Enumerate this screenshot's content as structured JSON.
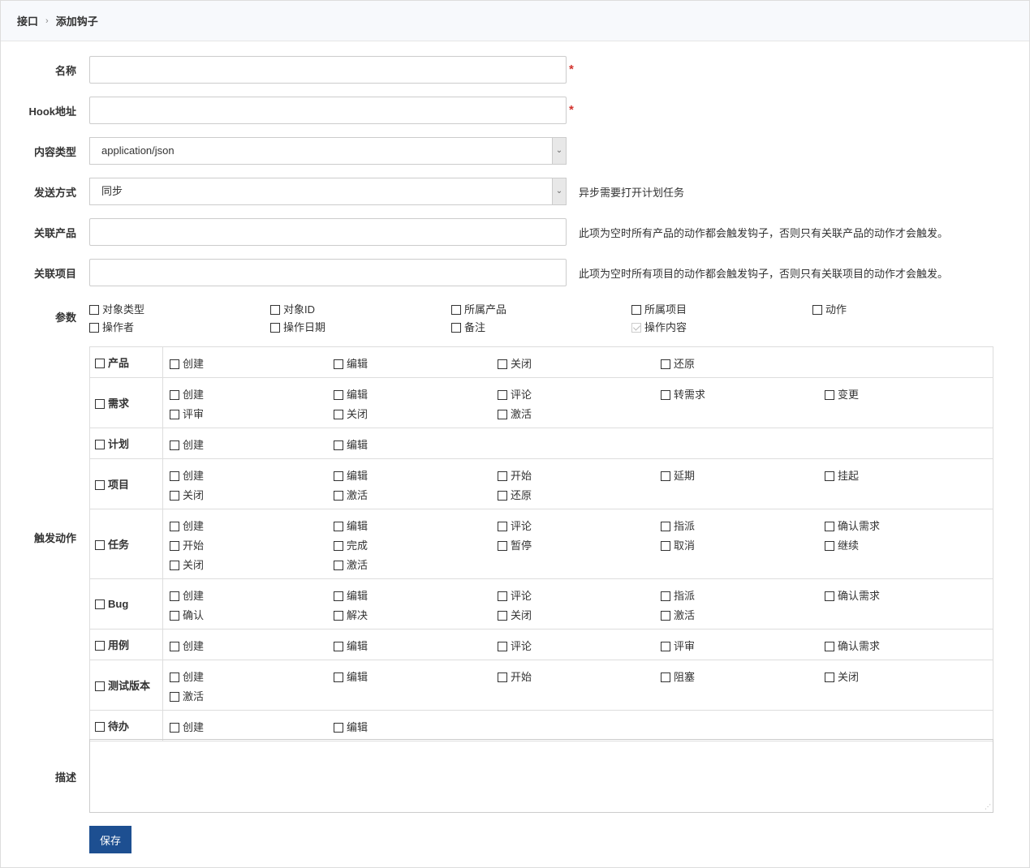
{
  "breadcrumb": {
    "parent": "接口",
    "separator": "›",
    "current": "添加钩子"
  },
  "form": {
    "name": {
      "label": "名称",
      "value": "",
      "required": "*"
    },
    "hook_url": {
      "label": "Hook地址",
      "value": "",
      "required": "*"
    },
    "content_type": {
      "label": "内容类型",
      "value": "application/json"
    },
    "send_type": {
      "label": "发送方式",
      "value": "同步",
      "help": "异步需要打开计划任务"
    },
    "products": {
      "label": "关联产品",
      "value": "",
      "help": "此项为空时所有产品的动作都会触发钩子，否则只有关联产品的动作才会触发。"
    },
    "projects": {
      "label": "关联项目",
      "value": "",
      "help": "此项为空时所有项目的动作都会触发钩子，否则只有关联项目的动作才会触发。"
    },
    "params": {
      "label": "参数",
      "options": [
        {
          "label": "对象类型",
          "checked": false
        },
        {
          "label": "对象ID",
          "checked": false
        },
        {
          "label": "所属产品",
          "checked": false
        },
        {
          "label": "所属项目",
          "checked": false
        },
        {
          "label": "动作",
          "checked": false
        },
        {
          "label": "操作者",
          "checked": false
        },
        {
          "label": "操作日期",
          "checked": false
        },
        {
          "label": "备注",
          "checked": false
        },
        {
          "label": "操作内容",
          "checked": true,
          "disabled": true
        }
      ]
    },
    "actions": {
      "label": "触发动作",
      "modules": [
        {
          "name": "产品",
          "actions": [
            "创建",
            "编辑",
            "关闭",
            "还原"
          ]
        },
        {
          "name": "需求",
          "actions": [
            "创建",
            "编辑",
            "评论",
            "转需求",
            "变更",
            "评审",
            "关闭",
            "激活"
          ]
        },
        {
          "name": "计划",
          "actions": [
            "创建",
            "编辑"
          ]
        },
        {
          "name": "项目",
          "actions": [
            "创建",
            "编辑",
            "开始",
            "延期",
            "挂起",
            "关闭",
            "激活",
            "还原"
          ]
        },
        {
          "name": "任务",
          "actions": [
            "创建",
            "编辑",
            "评论",
            "指派",
            "确认需求",
            "开始",
            "完成",
            "暂停",
            "取消",
            "继续",
            "关闭",
            "激活"
          ]
        },
        {
          "name": "Bug",
          "actions": [
            "创建",
            "编辑",
            "评论",
            "指派",
            "确认需求",
            "确认",
            "解决",
            "关闭",
            "激活"
          ]
        },
        {
          "name": "用例",
          "actions": [
            "创建",
            "编辑",
            "评论",
            "评审",
            "确认需求"
          ]
        },
        {
          "name": "测试版本",
          "actions": [
            "创建",
            "编辑",
            "开始",
            "阻塞",
            "关闭",
            "激活"
          ]
        },
        {
          "name": "待办",
          "actions": [
            "创建",
            "编辑"
          ]
        }
      ]
    },
    "desc": {
      "label": "描述",
      "value": ""
    },
    "save_label": "保存"
  },
  "colors": {
    "primary": "#1d4f91",
    "required": "#d2322d",
    "header_bg": "#f7f9fc"
  }
}
